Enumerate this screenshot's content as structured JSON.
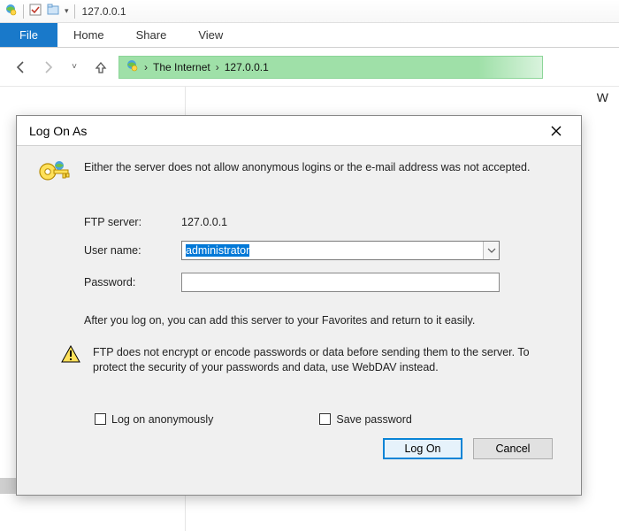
{
  "titlebar": {
    "title": "127.0.0.1"
  },
  "ribbon": {
    "file": "File",
    "tabs": [
      "Home",
      "Share",
      "View"
    ]
  },
  "breadcrumb": {
    "root": "The Internet",
    "current": "127.0.0.1"
  },
  "dialog": {
    "title": "Log On As",
    "message": "Either the server does not allow anonymous logins or the e-mail address was not accepted.",
    "ftp_label": "FTP server:",
    "ftp_value": "127.0.0.1",
    "user_label": "User name:",
    "user_value": "administrator",
    "pwd_label": "Password:",
    "pwd_value": "",
    "note": "After you log on, you can add this server to your Favorites and return to it easily.",
    "warn": "FTP does not encrypt or encode passwords or data before sending them to the server.  To protect the security of your passwords and data, use WebDAV instead.",
    "anon_label": "Log on anonymously",
    "save_label": "Save password",
    "logon_btn": "Log On",
    "cancel_btn": "Cancel"
  },
  "stray": {
    "w": "W"
  }
}
